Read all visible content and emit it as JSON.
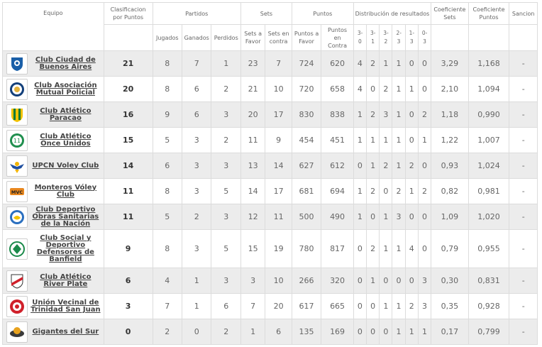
{
  "headers": {
    "team": "Equipo",
    "clasif": "Clasificacion por Puntos",
    "partidos": "Partidos",
    "jugados": "Jugados",
    "ganados": "Ganados",
    "perdidos": "Perdidos",
    "sets": "Sets",
    "sets_favor": "Sets a Favor",
    "sets_contra": "Sets en contra",
    "puntos": "Puntos",
    "puntos_favor": "Puntos a Favor",
    "puntos_contra": "Puntos en Contra",
    "distrib": "Distribución de resultados",
    "d30": "3-0",
    "d31": "3-1",
    "d32": "3-2",
    "d23": "2-3",
    "d13": "1-3",
    "d03": "0-3",
    "coef_sets": "Coeficiente Sets",
    "coef_puntos": "Coeficiente Puntos",
    "sancion": "Sancion"
  },
  "rows": [
    {
      "team": "Club Ciudad de Buenos Aires",
      "logo": "ciudad-shield-icon",
      "pts": "21",
      "j": "8",
      "g": "7",
      "p": "1",
      "sf": "23",
      "sc": "7",
      "pf": "724",
      "pc": "620",
      "d30": "4",
      "d31": "2",
      "d32": "1",
      "d23": "1",
      "d13": "0",
      "d03": "0",
      "cs": "3,29",
      "cp": "1,168",
      "san": "-"
    },
    {
      "team": "Club Asociación Mutual Policial",
      "logo": "policial-badge-icon",
      "pts": "20",
      "j": "8",
      "g": "6",
      "p": "2",
      "sf": "21",
      "sc": "10",
      "pf": "720",
      "pc": "658",
      "d30": "4",
      "d31": "0",
      "d32": "2",
      "d23": "1",
      "d13": "1",
      "d03": "0",
      "cs": "2,10",
      "cp": "1,094",
      "san": "-"
    },
    {
      "team": "Club Atlético Paracao",
      "logo": "paracao-shield-icon",
      "pts": "16",
      "j": "9",
      "g": "6",
      "p": "3",
      "sf": "20",
      "sc": "17",
      "pf": "830",
      "pc": "838",
      "d30": "1",
      "d31": "2",
      "d32": "3",
      "d23": "1",
      "d13": "0",
      "d03": "2",
      "cs": "1,18",
      "cp": "0,990",
      "san": "-"
    },
    {
      "team": "Club Atlético Once Unidos",
      "logo": "once-unidos-crest-icon",
      "pts": "15",
      "j": "5",
      "g": "3",
      "p": "2",
      "sf": "11",
      "sc": "9",
      "pf": "454",
      "pc": "451",
      "d30": "1",
      "d31": "1",
      "d32": "1",
      "d23": "1",
      "d13": "0",
      "d03": "1",
      "cs": "1,22",
      "cp": "1,007",
      "san": "-"
    },
    {
      "team": "UPCN Voley Club",
      "logo": "upcn-eagle-icon",
      "pts": "14",
      "j": "6",
      "g": "3",
      "p": "3",
      "sf": "13",
      "sc": "14",
      "pf": "627",
      "pc": "612",
      "d30": "0",
      "d31": "1",
      "d32": "2",
      "d23": "1",
      "d13": "2",
      "d03": "0",
      "cs": "0,93",
      "cp": "1,024",
      "san": "-"
    },
    {
      "team": "Monteros Vóley Club",
      "logo": "mvc-logo-icon",
      "pts": "11",
      "j": "8",
      "g": "3",
      "p": "5",
      "sf": "14",
      "sc": "17",
      "pf": "681",
      "pc": "694",
      "d30": "1",
      "d31": "2",
      "d32": "0",
      "d23": "2",
      "d13": "1",
      "d03": "2",
      "cs": "0,82",
      "cp": "0,981",
      "san": "-"
    },
    {
      "team": "Club Deportivo Obras Sanitarias de la Nación",
      "logo": "obras-sanitarias-icon",
      "pts": "11",
      "j": "5",
      "g": "2",
      "p": "3",
      "sf": "12",
      "sc": "11",
      "pf": "500",
      "pc": "490",
      "d30": "1",
      "d31": "0",
      "d32": "1",
      "d23": "3",
      "d13": "0",
      "d03": "0",
      "cs": "1,09",
      "cp": "1,020",
      "san": "-"
    },
    {
      "team": "Club Social y Deportivo Defensores de Banfield",
      "logo": "defensores-banfield-icon",
      "pts": "9",
      "j": "8",
      "g": "3",
      "p": "5",
      "sf": "15",
      "sc": "19",
      "pf": "780",
      "pc": "817",
      "d30": "0",
      "d31": "2",
      "d32": "1",
      "d23": "1",
      "d13": "4",
      "d03": "0",
      "cs": "0,79",
      "cp": "0,955",
      "san": "-"
    },
    {
      "team": "Club Atlético River Plate",
      "logo": "river-plate-icon",
      "pts": "6",
      "j": "4",
      "g": "1",
      "p": "3",
      "sf": "3",
      "sc": "10",
      "pf": "266",
      "pc": "320",
      "d30": "0",
      "d31": "1",
      "d32": "0",
      "d23": "0",
      "d13": "0",
      "d03": "3",
      "cs": "0,30",
      "cp": "0,831",
      "san": "-"
    },
    {
      "team": "Unión Vecinal de Trinidad San Juan",
      "logo": "union-vecinal-icon",
      "pts": "3",
      "j": "7",
      "g": "1",
      "p": "6",
      "sf": "7",
      "sc": "20",
      "pf": "617",
      "pc": "665",
      "d30": "0",
      "d31": "0",
      "d32": "1",
      "d23": "1",
      "d13": "2",
      "d03": "3",
      "cs": "0,35",
      "cp": "0,928",
      "san": "-"
    },
    {
      "team": "Gigantes del Sur",
      "logo": "gigantes-sur-icon",
      "pts": "0",
      "j": "2",
      "g": "0",
      "p": "2",
      "sf": "1",
      "sc": "6",
      "pf": "135",
      "pc": "169",
      "d30": "0",
      "d31": "0",
      "d32": "0",
      "d23": "1",
      "d13": "1",
      "d03": "1",
      "cs": "0,17",
      "cp": "0,799",
      "san": "-"
    }
  ]
}
